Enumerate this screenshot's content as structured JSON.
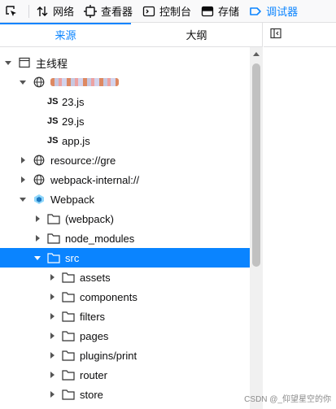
{
  "toolbar": {
    "items": [
      {
        "label": "网络",
        "icon": "network-arrows-icon"
      },
      {
        "label": "查看器",
        "icon": "inspector-icon"
      },
      {
        "label": "控制台",
        "icon": "console-icon"
      },
      {
        "label": "存储",
        "icon": "storage-icon"
      },
      {
        "label": "调试器",
        "icon": "debugger-icon",
        "active": true
      }
    ],
    "accent": "#0a84ff"
  },
  "source_tabs": {
    "sources": "来源",
    "outline": "大纲"
  },
  "tree": {
    "main_thread": "主线程",
    "files": [
      "23.js",
      "29.js",
      "app.js"
    ],
    "resource": "resource://gre",
    "webpack_internal": "webpack-internal://",
    "webpack": "Webpack",
    "webpack_children": [
      "(webpack)",
      "node_modules",
      "src"
    ],
    "src_children": [
      "assets",
      "components",
      "filters",
      "pages",
      "plugins/print",
      "router",
      "store"
    ],
    "js_label": "JS"
  },
  "watermark": "CSDN @_仰望星空的你"
}
